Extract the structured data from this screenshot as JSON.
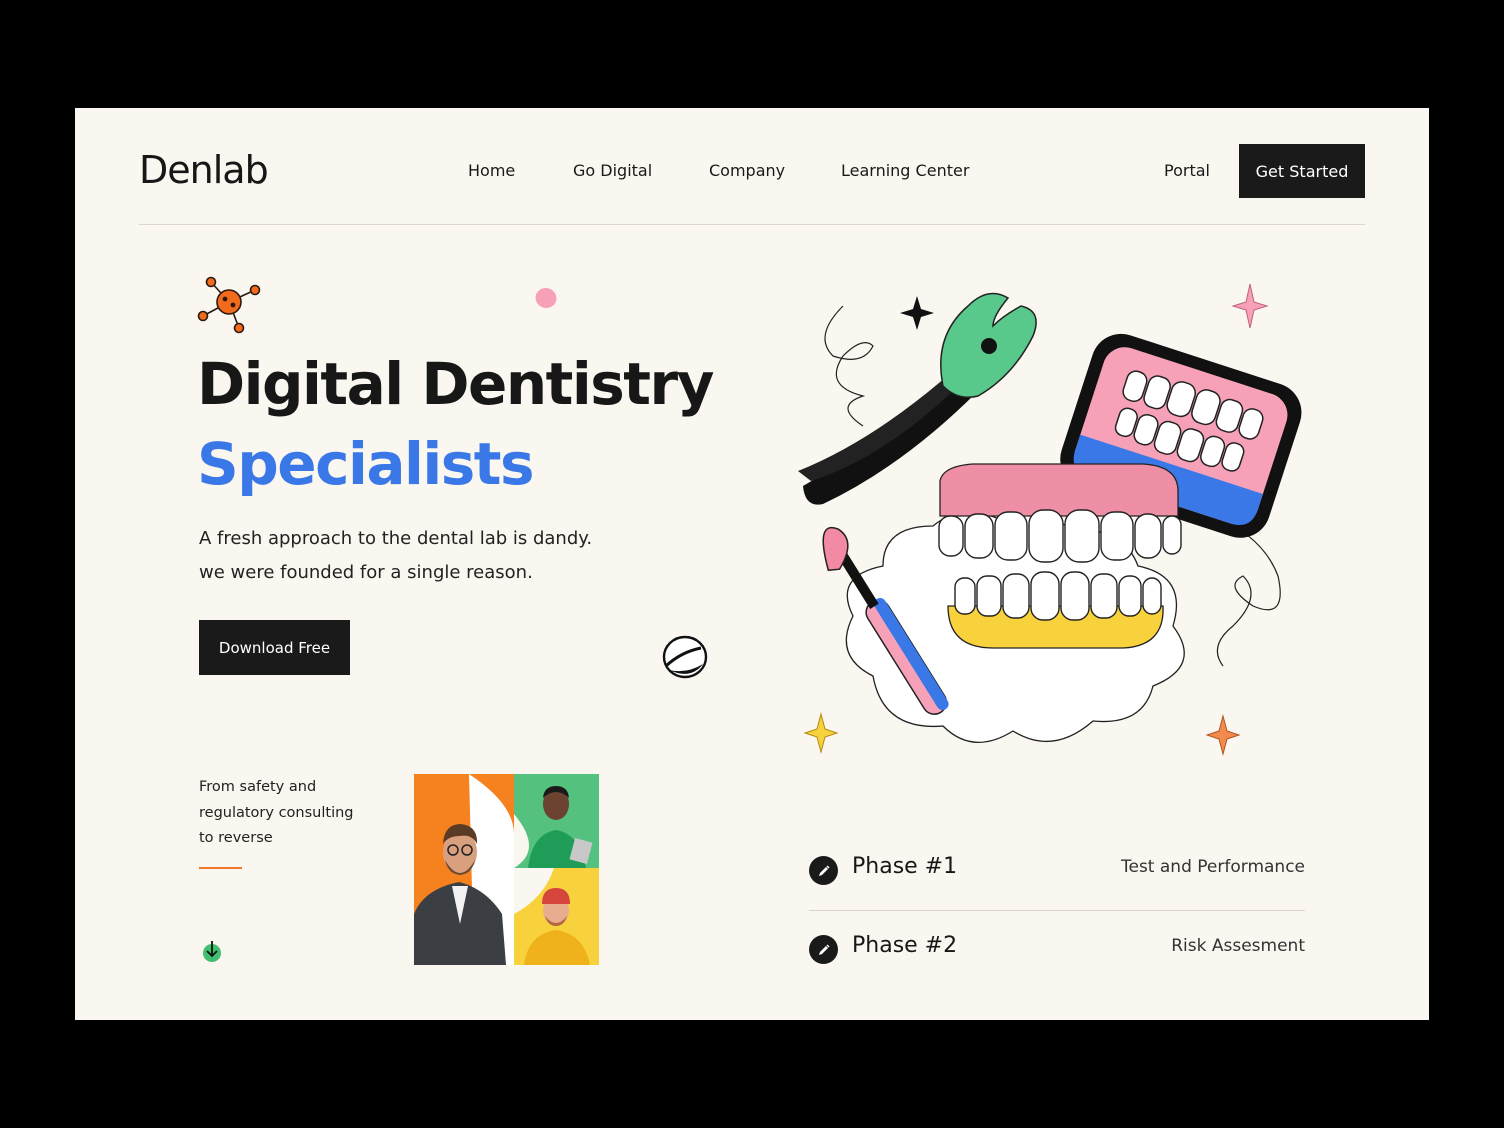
{
  "brand": {
    "logo_text": "Denlab"
  },
  "nav": {
    "items": [
      {
        "label": "Home"
      },
      {
        "label": "Go Digital"
      },
      {
        "label": "Company"
      },
      {
        "label": "Learning Center"
      }
    ],
    "portal_label": "Portal",
    "cta_label": "Get Started"
  },
  "hero": {
    "title_line1": "Digital Dentistry",
    "title_line2": "Specialists",
    "title_accent_color": "#3b78e7",
    "description_line1": "A fresh approach to the dental lab is dandy.",
    "description_line2": "we were founded for a single reason.",
    "download_label": "Download Free"
  },
  "side_note": {
    "line1": "From safety and",
    "line2": "regulatory consulting",
    "line3": "to reverse",
    "accent_color": "#f2782c"
  },
  "icons": {
    "molecule": "molecule-icon",
    "scroll_down": "arrow-down-icon",
    "phase": "pen-icon"
  },
  "phases": [
    {
      "title": "Phase #1",
      "description": "Test and Performance"
    },
    {
      "title": "Phase #2",
      "description": "Risk Assesment"
    }
  ],
  "colors": {
    "page_bg": "#faf6f0",
    "dark": "#1a1a1a",
    "blue": "#3b78e7",
    "orange": "#f5821f",
    "green": "#5cc58a",
    "yellow": "#f8d23c",
    "pink": "#f7a1b8"
  }
}
